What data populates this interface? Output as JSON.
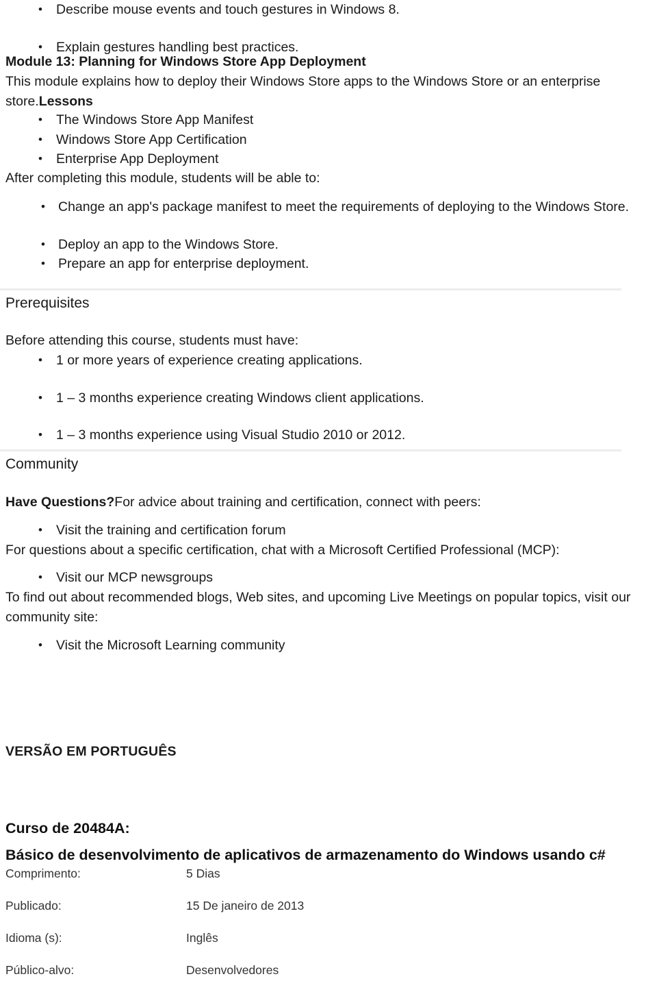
{
  "document": {
    "top_bullets": [
      "Describe mouse events and touch gestures in Windows 8.",
      "Explain gestures handling best practices."
    ],
    "module": {
      "heading": "Module 13: Planning for Windows Store App Deployment",
      "description": "This module explains how to deploy their Windows Store apps to the Windows Store or an enterprise store.",
      "lessons_label": "Lessons",
      "lessons": [
        "The Windows Store App Manifest",
        "Windows Store App Certification",
        "Enterprise App Deployment"
      ],
      "objectives_intro": "After completing this module, students will be able to:",
      "objectives": [
        "Change an app's package manifest to meet the requirements of deploying to the Windows Store.",
        "Deploy an app to the Windows Store.",
        "Prepare an app for enterprise deployment."
      ]
    },
    "prerequisites": {
      "heading": "Prerequisites",
      "intro": "Before attending this course, students must have:",
      "items": [
        "1 or more years of experience creating applications.",
        "1 – 3 months experience creating Windows client applications.",
        "1 – 3 months experience using Visual Studio 2010 or 2012."
      ]
    },
    "community": {
      "heading": "Community",
      "have_questions_bold": "Have Questions?",
      "have_questions_rest": "For advice about training and certification, connect with peers:",
      "forum_link": "Visit the training and certification forum",
      "mcp_intro": "For questions about a specific certification, chat with a Microsoft Certified Professional (MCP):",
      "mcp_link": "Visit our MCP newsgroups",
      "blogs_intro": "To find out about recommended blogs, Web sites, and upcoming Live Meetings on popular topics, visit our community site:",
      "learning_link": "Visit the Microsoft Learning community"
    },
    "portuguese": {
      "version_label": "VERSÃO EM PORTUGUÊS",
      "course_code": "Curso de 20484A:",
      "course_title": "Básico de desenvolvimento de aplicativos de armazenamento do Windows usando c#",
      "meta_rows": [
        {
          "key": "Comprimento:",
          "value": "5 Dias"
        },
        {
          "key": "Publicado:",
          "value": "15 De janeiro de 2013"
        },
        {
          "key": "Idioma (s):",
          "value": "Inglês"
        },
        {
          "key": "Público-alvo:",
          "value": "Desenvolvedores"
        }
      ]
    }
  },
  "colors": {
    "text": "#1a1a1a",
    "rule": "#ededed",
    "background": "#ffffff"
  }
}
